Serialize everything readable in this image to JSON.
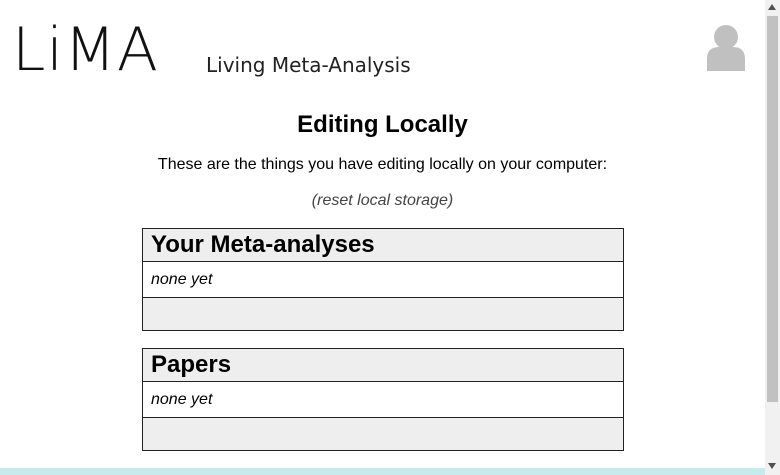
{
  "header": {
    "logo": "LiMA",
    "tagline": "Living Meta-Analysis",
    "user_icon": "user-avatar-icon"
  },
  "main": {
    "title": "Editing Locally",
    "intro": "These are the things you have editing locally on your computer:",
    "reset_link": "(reset local storage)",
    "sections": [
      {
        "heading": "Your Meta-analyses",
        "empty_text": "none yet"
      },
      {
        "heading": "Papers",
        "empty_text": "none yet"
      }
    ]
  },
  "colors": {
    "panel_background": "#eeeeee",
    "bottom_bar": "#c7eaed"
  }
}
